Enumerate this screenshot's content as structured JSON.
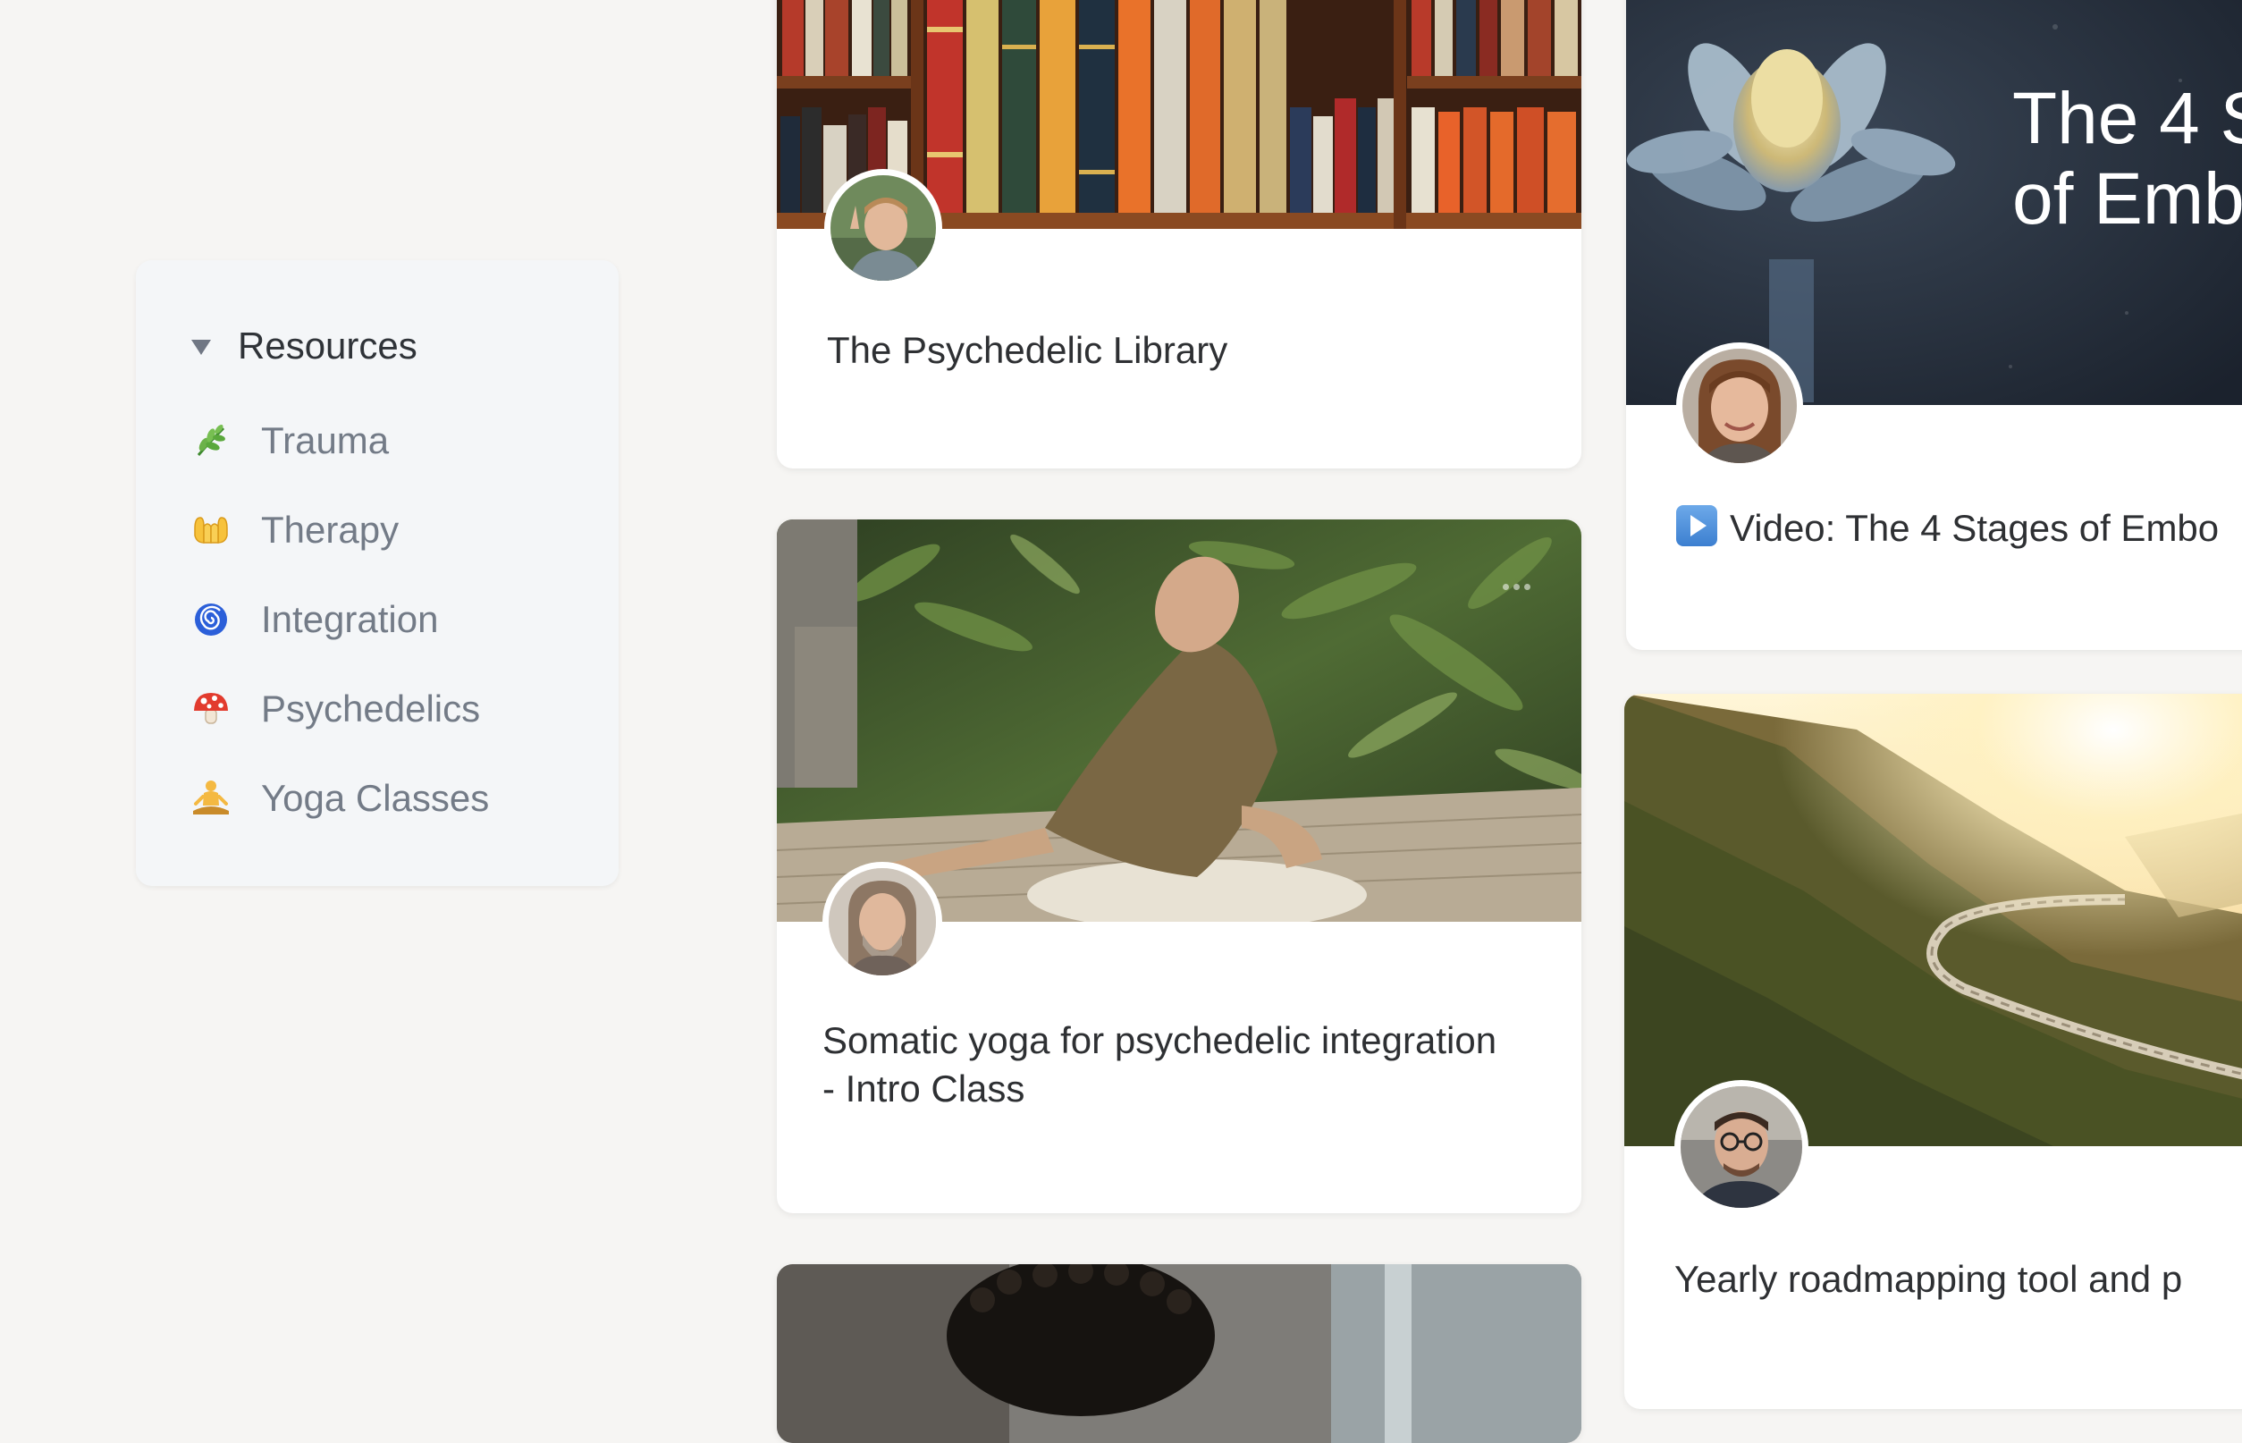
{
  "sidebar": {
    "title": "Resources",
    "items": [
      {
        "label": "Trauma",
        "icon": "herb-icon"
      },
      {
        "label": "Therapy",
        "icon": "open-hands-icon"
      },
      {
        "label": "Integration",
        "icon": "spiral-icon"
      },
      {
        "label": "Psychedelics",
        "icon": "mushroom-icon"
      },
      {
        "label": "Yoga Classes",
        "icon": "person-meditating-icon"
      }
    ]
  },
  "cards": {
    "library": {
      "title": "The Psychedelic Library"
    },
    "somatic": {
      "title_line1": "Somatic yoga for psychedelic integration",
      "title_line2": "- Intro Class"
    },
    "video": {
      "title": "Video: The 4 Stages of Embo",
      "banner_line1": "The 4 S",
      "banner_line2": "of Emb"
    },
    "roadmap": {
      "title": "Yearly roadmapping tool and p"
    }
  },
  "colors": {
    "background": "#f6f5f3",
    "sidebar_bg": "#f4f6f8",
    "card_bg": "#ffffff",
    "label_muted": "#737b87"
  }
}
